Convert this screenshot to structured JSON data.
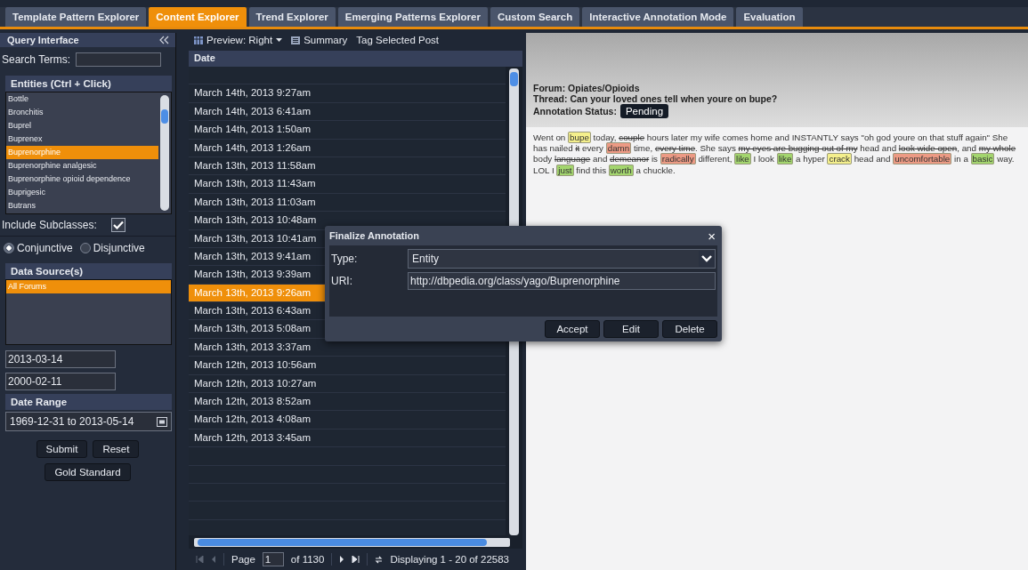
{
  "tabs": [
    {
      "label": "Template Pattern Explorer",
      "selected": false
    },
    {
      "label": "Content Explorer",
      "selected": true
    },
    {
      "label": "Trend Explorer",
      "selected": false
    },
    {
      "label": "Emerging Patterns Explorer",
      "selected": false
    },
    {
      "label": "Custom Search",
      "selected": false
    },
    {
      "label": "Interactive Annotation Mode",
      "selected": false
    },
    {
      "label": "Evaluation",
      "selected": false
    }
  ],
  "query": {
    "title": "Query Interface",
    "search_label": "Search Terms:",
    "entities_title": "Entities (Ctrl + Click)",
    "entities": [
      {
        "label": "Bottle",
        "selected": false
      },
      {
        "label": "Bronchitis",
        "selected": false
      },
      {
        "label": "Buprel",
        "selected": false
      },
      {
        "label": "Buprenex",
        "selected": false
      },
      {
        "label": "Buprenorphine",
        "selected": true
      },
      {
        "label": "Buprenorphine analgesic",
        "selected": false
      },
      {
        "label": "Buprenorphine opioid dependence",
        "selected": false
      },
      {
        "label": "Buprigesic",
        "selected": false
      },
      {
        "label": "Butrans",
        "selected": false
      }
    ],
    "include_subclasses": {
      "label": "Include Subclasses:",
      "checked": true
    },
    "modes": [
      {
        "label": "Conjunctive",
        "selected": true
      },
      {
        "label": "Disjunctive",
        "selected": false
      }
    ],
    "sources_title": "Data Source(s)",
    "sources": [
      {
        "label": "All Forums",
        "selected": true
      }
    ],
    "dates": [
      "2013-03-14",
      "2000-02-11"
    ],
    "date_range_title": "Date Range",
    "date_range": "1969-12-31 to 2013-05-14",
    "buttons": [
      "Submit",
      "Reset"
    ],
    "gold_button": "Gold Standard"
  },
  "posts": {
    "toolbar": [
      "Preview: Right",
      "Summary",
      "Tag Selected Post"
    ],
    "column": "Date",
    "rows": [
      {
        "date": "March 14th, 2013 9:27am",
        "selected": false
      },
      {
        "date": "March 14th, 2013 6:41am",
        "selected": false
      },
      {
        "date": "March 14th, 2013 1:50am",
        "selected": false
      },
      {
        "date": "March 14th, 2013 1:26am",
        "selected": false
      },
      {
        "date": "March 13th, 2013 11:58am",
        "selected": false
      },
      {
        "date": "March 13th, 2013 11:43am",
        "selected": false
      },
      {
        "date": "March 13th, 2013 11:03am",
        "selected": false
      },
      {
        "date": "March 13th, 2013 10:48am",
        "selected": false
      },
      {
        "date": "March 13th, 2013 10:41am",
        "selected": false
      },
      {
        "date": "March 13th, 2013 9:41am",
        "selected": false
      },
      {
        "date": "March 13th, 2013 9:39am",
        "selected": false
      },
      {
        "date": "March 13th, 2013 9:26am",
        "selected": true
      },
      {
        "date": "March 13th, 2013 6:43am",
        "selected": false
      },
      {
        "date": "March 13th, 2013 5:08am",
        "selected": false
      },
      {
        "date": "March 13th, 2013 3:37am",
        "selected": false
      },
      {
        "date": "March 12th, 2013 10:56am",
        "selected": false
      },
      {
        "date": "March 12th, 2013 10:27am",
        "selected": false
      },
      {
        "date": "March 12th, 2013 8:52am",
        "selected": false
      },
      {
        "date": "March 12th, 2013 4:08am",
        "selected": false
      },
      {
        "date": "March 12th, 2013 3:45am",
        "selected": false
      }
    ],
    "pager": {
      "page_label": "Page",
      "page": "1",
      "of": "of 1130",
      "displaying": "Displaying 1 - 20 of 22583"
    }
  },
  "preview": {
    "forum": "Forum: Opiates/Opioids",
    "thread": "Thread: Can your loved ones tell when youre on bupe?",
    "status_label": "Annotation Status:",
    "status": "Pending",
    "segments": [
      {
        "kind": "plain",
        "text": "Went on "
      },
      {
        "kind": "tag",
        "text": "bupe",
        "color": "#f4ef8c"
      },
      {
        "kind": "plain",
        "text": " today, "
      },
      {
        "kind": "struck",
        "text": "couple"
      },
      {
        "kind": "plain",
        "text": " hours later my wife comes home and INSTANTLY says \"oh god youre on that stuff again\" She has nailed "
      },
      {
        "kind": "struck",
        "text": "it"
      },
      {
        "kind": "plain",
        "text": " every "
      },
      {
        "kind": "tag",
        "text": "damn",
        "color": "#ec9a84"
      },
      {
        "kind": "plain",
        "text": " time, "
      },
      {
        "kind": "struck",
        "text": "every time"
      },
      {
        "kind": "plain",
        "text": ". She says "
      },
      {
        "kind": "struck",
        "text": "my eyes are bugging out of my"
      },
      {
        "kind": "plain",
        "text": " head and "
      },
      {
        "kind": "struck",
        "text": "look wide open"
      },
      {
        "kind": "plain",
        "text": ", and "
      },
      {
        "kind": "struck",
        "text": "my whole"
      },
      {
        "kind": "plain",
        "text": " body "
      },
      {
        "kind": "struck",
        "text": "language"
      },
      {
        "kind": "plain",
        "text": " and "
      },
      {
        "kind": "struck",
        "text": "demeanor"
      },
      {
        "kind": "plain",
        "text": " is "
      },
      {
        "kind": "tag",
        "text": "radically",
        "color": "#ec9a84"
      },
      {
        "kind": "plain",
        "text": " different, "
      },
      {
        "kind": "tag",
        "text": "like",
        "color": "#a3d56e"
      },
      {
        "kind": "plain",
        "text": " I look "
      },
      {
        "kind": "tag",
        "text": "like",
        "color": "#a3d56e"
      },
      {
        "kind": "plain",
        "text": " a hyper "
      },
      {
        "kind": "tag",
        "text": "crack",
        "color": "#f4ef8c"
      },
      {
        "kind": "plain",
        "text": " head and "
      },
      {
        "kind": "tag",
        "text": "uncomfortable",
        "color": "#ec9a84"
      },
      {
        "kind": "plain",
        "text": " in a "
      },
      {
        "kind": "tag",
        "text": "basic",
        "color": "#a3d56e"
      },
      {
        "kind": "plain",
        "text": " way. LOL I "
      },
      {
        "kind": "tag",
        "text": "just",
        "color": "#a3d56e"
      },
      {
        "kind": "plain",
        "text": " find this "
      },
      {
        "kind": "tag",
        "text": "worth",
        "color": "#a3d56e"
      },
      {
        "kind": "plain",
        "text": " a chuckle."
      }
    ]
  },
  "dialog": {
    "title": "Finalize Annotation",
    "close": "×",
    "type_label": "Type:",
    "type_value": "Entity",
    "uri_label": "URI:",
    "uri_value": "http://dbpedia.org/class/yago/Buprenorphine",
    "buttons": [
      "Accept",
      "Edit",
      "Delete"
    ]
  }
}
